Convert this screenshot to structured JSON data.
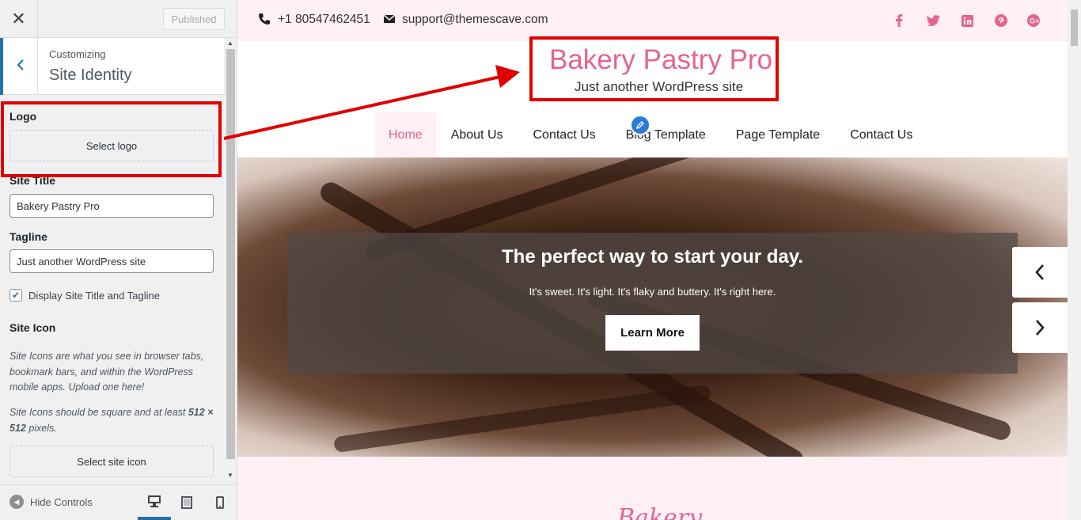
{
  "sidebar": {
    "published_label": "Published",
    "customizing_label": "Customizing",
    "panel_title": "Site Identity",
    "logo": {
      "label": "Logo",
      "button": "Select logo"
    },
    "site_title": {
      "label": "Site Title",
      "value": "Bakery Pastry Pro"
    },
    "tagline": {
      "label": "Tagline",
      "value": "Just another WordPress site"
    },
    "display_title_tagline": {
      "label": "Display Site Title and Tagline",
      "checked": true
    },
    "site_icon": {
      "label": "Site Icon",
      "desc1": "Site Icons are what you see in browser tabs, bookmark bars, and within the WordPress mobile apps. Upload one here!",
      "desc2_prefix": "Site Icons should be square and at least ",
      "desc2_size": "512 × 512",
      "desc2_suffix": " pixels.",
      "button": "Select site icon"
    },
    "footer": {
      "hide_controls": "Hide Controls"
    }
  },
  "preview": {
    "topbar": {
      "phone": "+1 80547462451",
      "email": "support@themescave.com",
      "social_icons": [
        "facebook-icon",
        "twitter-icon",
        "linkedin-icon",
        "pinterest-icon",
        "google-plus-icon"
      ],
      "icon_color": "#e4648e"
    },
    "site_title": "Bakery Pastry Pro",
    "site_tagline": "Just another WordPress site",
    "menu": [
      "Home",
      "About Us",
      "Contact Us",
      "Blog Template",
      "Page Template",
      "Contact Us"
    ],
    "active_menu": "Home",
    "slider": {
      "heading": "The perfect way to start your day.",
      "text": "It's sweet. It's light. It's flaky and buttery. It's right here.",
      "button": "Learn More"
    },
    "section_title": "Bakery"
  },
  "colors": {
    "accent": "#e4648e",
    "wp_blue": "#2271b1",
    "annotation_red": "#e10000",
    "pink_bg": "#fff0f5"
  }
}
